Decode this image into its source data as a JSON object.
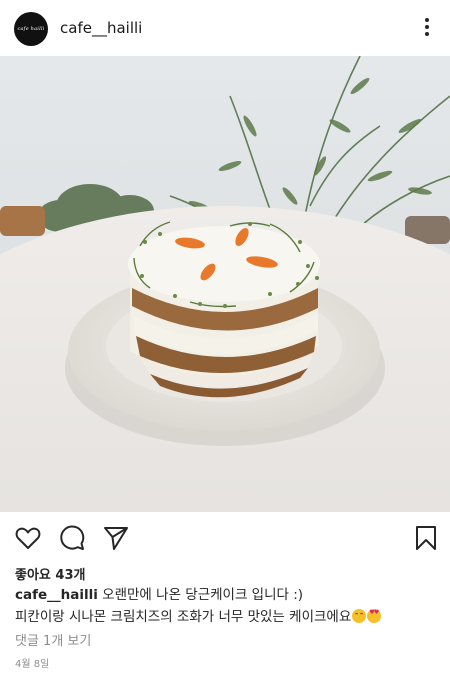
{
  "header": {
    "avatar_text": "cafe hailli",
    "username": "cafe__hailli",
    "more_icon": "more-vertical-icon"
  },
  "post": {
    "image_description_icon": "post-photo"
  },
  "actions": {
    "like_icon": "heart-icon",
    "comment_icon": "comment-icon",
    "share_icon": "send-icon",
    "save_icon": "bookmark-icon"
  },
  "likes": "좋아요 43개",
  "caption": {
    "username": "cafe__hailli",
    "line1": "오랜만에 나온 당근케이크 입니다 :)",
    "line2": "피칸이랑 시나몬 크림치즈의 조화가 너무 맛있는 케이크에요"
  },
  "comments_link": "댓글 1개 보기",
  "date": "4월 8일"
}
